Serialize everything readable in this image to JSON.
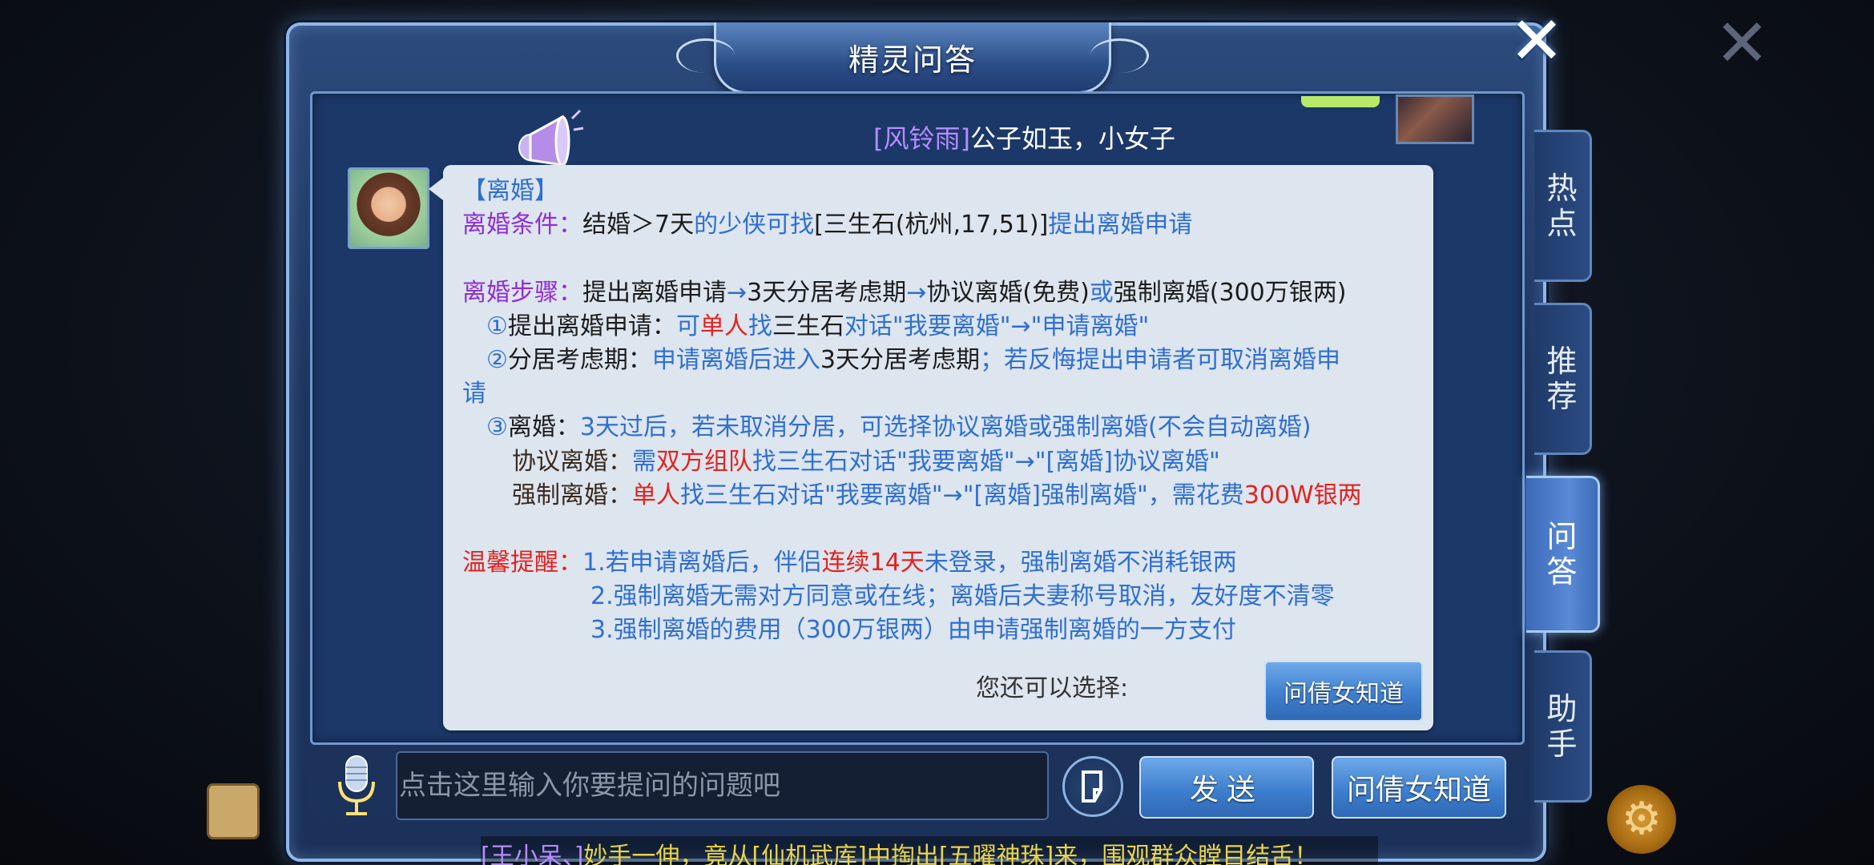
{
  "window": {
    "title": "精灵问答",
    "close_glyph": "✕"
  },
  "marquee": {
    "name": "[风铃雨]",
    "text": "公子如玉，小女子"
  },
  "card": {
    "heading": "【离婚】",
    "conditions": {
      "label": "离婚条件：",
      "p1": "结婚＞7天",
      "p2": "的少侠可找",
      "p3": "[三生石(杭州,17,51)]",
      "p4": "提出离婚申请"
    },
    "steps": {
      "label": "离婚步骤：",
      "s1": "提出离婚申请",
      "arrow": "→",
      "s2": "3天分居考虑期",
      "s3": "协议离婚(免费)",
      "or": "或",
      "s4": "强制离婚(300万银两)"
    },
    "step1": {
      "num": "①",
      "title": "提出离婚申请：",
      "p1": "可",
      "p2": "单人",
      "p3": "找",
      "p4": "三生石",
      "p5": "对话\"我要离婚\"→\"申请离婚\""
    },
    "step2": {
      "num": "②",
      "title": "分居考虑期：",
      "p1": "申请离婚后进入",
      "p2": "3天分居考虑期",
      "p3": "；若反悔提出申请者可取消离婚申",
      "p4": "请"
    },
    "step3": {
      "num": "③",
      "title": "离婚：",
      "p1": "3天过后，若未取消分居，可选择协议离婚或强制离婚(不会自动离婚)"
    },
    "agree": {
      "title": "协议离婚：",
      "p1": "需",
      "p2": "双方组队",
      "p3": "找三生石对话\"我要离婚\"→\"[离婚]协议离婚\""
    },
    "force": {
      "title": "强制离婚：",
      "p1": "单人",
      "p2": "找三生石对话\"我要离婚\"→\"[离婚]强制离婚\"，需花费",
      "p3": "300W银两"
    },
    "tips": {
      "label": "温馨提醒：",
      "t1a": "1.若申请离婚后，伴侣",
      "t1b": "连续14天",
      "t1c": "未登录，强制离婚不消耗银两",
      "t2": "2.强制离婚无需对方同意或在线；离婚后夫妻称号取消，友好度不清零",
      "t3": "3.强制离婚的费用（300万银两）由申请强制离婚的一方支付"
    },
    "more_label": "您还可以选择:",
    "ask_button": "问倩女知道"
  },
  "tabs": [
    {
      "label": "热点",
      "c1": "热",
      "c2": "点"
    },
    {
      "label": "推荐",
      "c1": "推",
      "c2": "荐"
    },
    {
      "label": "问答",
      "c1": "问",
      "c2": "答"
    },
    {
      "label": "助手",
      "c1": "助",
      "c2": "手"
    }
  ],
  "input": {
    "placeholder": "点击这里输入你要提问的问题吧",
    "value": ""
  },
  "buttons": {
    "send": "发送",
    "ask": "问倩女知道"
  },
  "ticker": {
    "name": "[王小呆、]",
    "text": "妙手一伸，竟从[仙机武库]中掏出[五曜神珠]来，围观群众瞠目结舌！"
  },
  "colors": {
    "accent_blue": "#2f6fd1",
    "purple_label": "#8e2dd6",
    "red_highlight": "#e2231f",
    "frame": "#8fb6e6"
  }
}
